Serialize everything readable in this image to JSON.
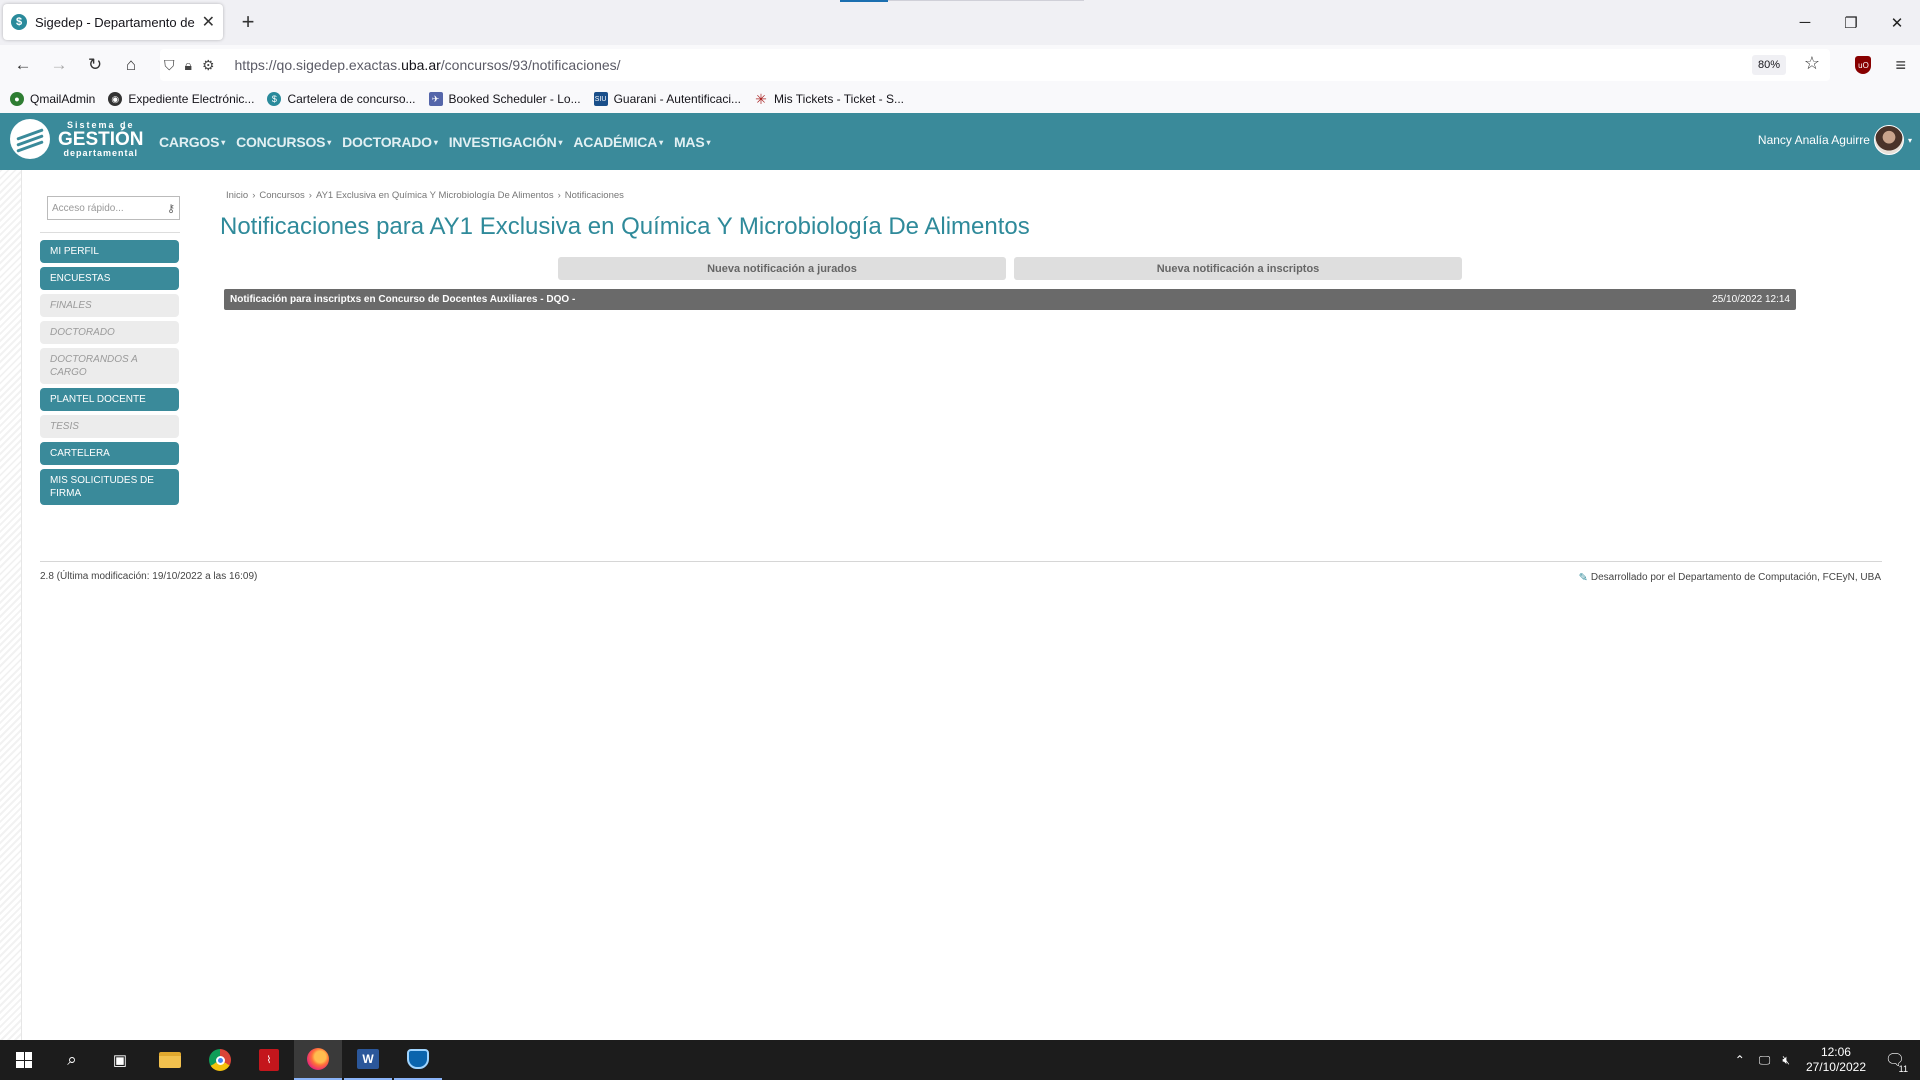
{
  "browser": {
    "tab_title": "Sigedep - Departamento de Quí",
    "tab_favicon": "$",
    "url_prefix": "https://qo.sigedep.exactas.",
    "url_domain": "uba.ar",
    "url_path": "/concursos/93/notificaciones/",
    "zoom": "80%",
    "bookmarks": [
      {
        "label": "QmailAdmin",
        "icon": "qmail-icon",
        "color": "#2e7d32"
      },
      {
        "label": "Expediente Electrónic...",
        "icon": "expediente-icon",
        "color": "#333333"
      },
      {
        "label": "Cartelera de concurso...",
        "icon": "sigedep-icon",
        "color": "#2a8a9b"
      },
      {
        "label": "Booked Scheduler - Lo...",
        "icon": "booked-icon",
        "color": "#5566aa"
      },
      {
        "label": "Guarani - Autentificaci...",
        "icon": "siu-icon",
        "color": "#1a4f8a"
      },
      {
        "label": "Mis Tickets - Ticket - S...",
        "icon": "tickets-icon",
        "color": "#aa2222"
      }
    ]
  },
  "site": {
    "logo": {
      "line1": "Sistema de",
      "line2": "GESTIÓN",
      "line3": "departamental"
    },
    "menu": [
      "CARGOS",
      "CONCURSOS",
      "DOCTORADO",
      "INVESTIGACIÓN",
      "ACADÉMICA",
      "MAS"
    ],
    "user_name": "Nancy Analía Aguirre"
  },
  "sidebar": {
    "quick_placeholder": "Acceso rápido...",
    "items": [
      {
        "label": "MI PERFIL",
        "enabled": true
      },
      {
        "label": "ENCUESTAS",
        "enabled": true
      },
      {
        "label": "FINALES",
        "enabled": false
      },
      {
        "label": "DOCTORADO",
        "enabled": false
      },
      {
        "label": "DOCTORANDOS A CARGO",
        "enabled": false
      },
      {
        "label": "PLANTEL DOCENTE",
        "enabled": true
      },
      {
        "label": "TESIS",
        "enabled": false
      },
      {
        "label": "CARTELERA",
        "enabled": true
      },
      {
        "label": "MIS SOLICITUDES DE FIRMA",
        "enabled": true
      }
    ]
  },
  "main": {
    "breadcrumb": [
      "Inicio",
      "Concursos",
      "AY1 Exclusiva en Química Y Microbiología De Alimentos",
      "Notificaciones"
    ],
    "title": "Notificaciones para AY1 Exclusiva en Química Y Microbiología De Alimentos",
    "btn_jurados": "Nueva notificación a jurados",
    "btn_inscriptos": "Nueva notificación a inscriptos",
    "notifications": [
      {
        "text": "Notificación para inscriptxs en Concurso de Docentes Auxiliares - DQO -",
        "date": "25/10/2022 12:14"
      }
    ]
  },
  "footer": {
    "version": "2.8 (Última modificación: 19/10/2022 a las 16:09)",
    "credit": "Desarrollado por el Departamento de Computación, FCEyN, UBA"
  },
  "taskbar": {
    "time": "12:06",
    "date": "27/10/2022",
    "notif_count": "11"
  }
}
